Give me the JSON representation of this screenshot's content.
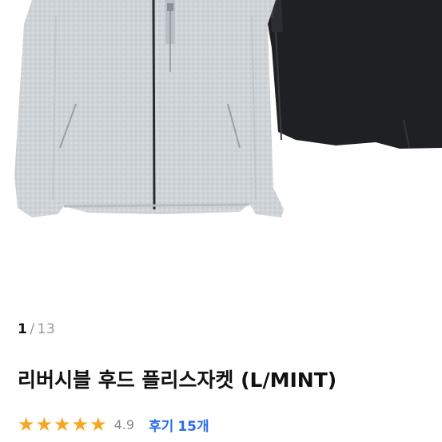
{
  "pager": {
    "current": "1",
    "separator": "/",
    "total": "13"
  },
  "product": {
    "title": "리버시블 후드 플리스자켓 (L/MINT)",
    "rating": {
      "stars": 5,
      "score": "4.9"
    },
    "reviews": {
      "label": "후기",
      "count": "15개"
    }
  },
  "colors": {
    "star": "#F5A623",
    "link": "#2B6DE8"
  },
  "icons": {
    "star": "star-icon"
  }
}
